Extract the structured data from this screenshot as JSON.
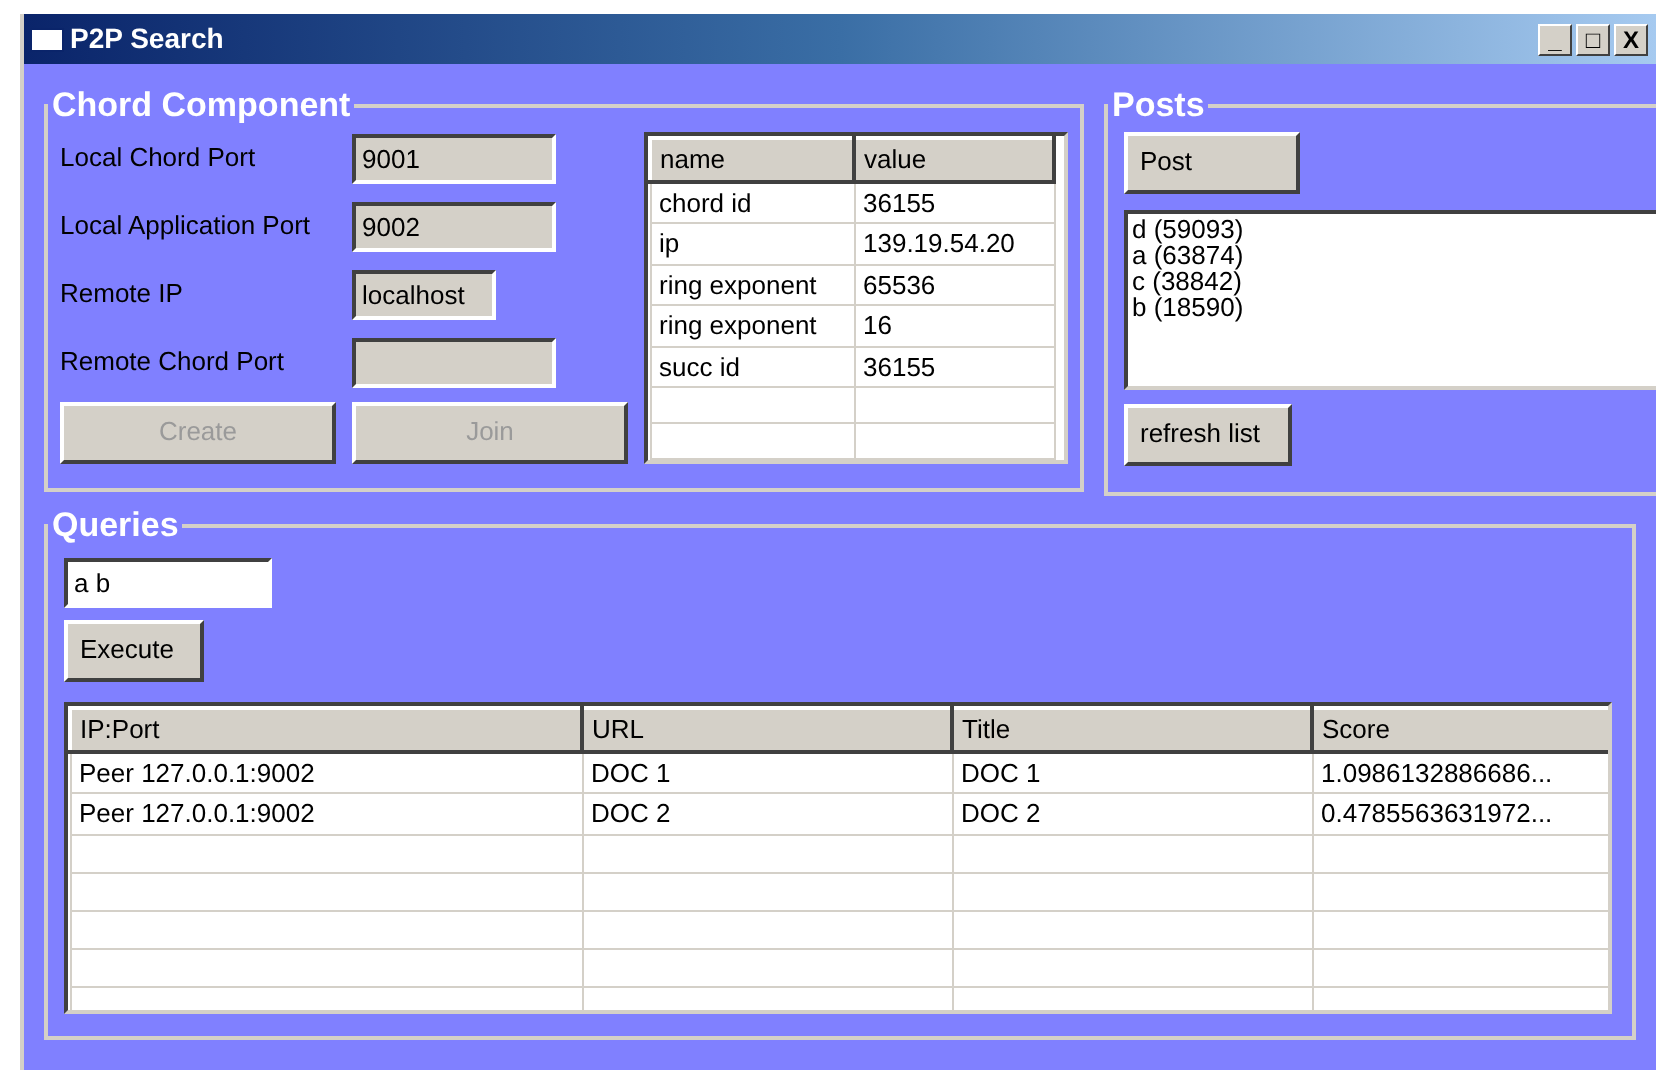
{
  "window": {
    "title": "P2P Search",
    "controls": [
      "_",
      "□",
      "X"
    ]
  },
  "chord": {
    "title": "Chord Component",
    "fields": [
      {
        "label": "Local Chord Port",
        "value": "9001",
        "disabled": true
      },
      {
        "label": "Local Application Port",
        "value": "9002",
        "disabled": true
      },
      {
        "label": "Remote IP",
        "value": "localhost",
        "disabled": true
      },
      {
        "label": "Remote Chord Port",
        "disabled": true
      }
    ],
    "buttons": [
      {
        "label": "Create",
        "disabled": true
      },
      {
        "label": "Join",
        "disabled": true
      }
    ],
    "table": {
      "columns": [
        "name",
        "value"
      ],
      "rows": [
        [
          "chord id",
          "36155"
        ],
        [
          "ip",
          "139.19.54.20"
        ],
        [
          "ring exponent",
          "65536"
        ],
        [
          "ring exponent",
          "16"
        ],
        [
          "succ id",
          "36155"
        ]
      ]
    }
  },
  "posts": {
    "title": "Posts",
    "post_button": {
      "label": "Post",
      "disabled": false
    },
    "items": [
      "d (59093)",
      "a (63874)",
      "c (38842)",
      "b (18590)"
    ],
    "refresh_button": {
      "label": "refresh list",
      "disabled": false
    }
  },
  "queries": {
    "title": "Queries",
    "query": {
      "value": "a b",
      "disabled": false
    },
    "execute_button": {
      "label": "Execute",
      "disabled": false
    },
    "table": {
      "columns": [
        "IP:Port",
        "URL",
        "Title",
        "Score"
      ],
      "rows": [
        [
          "Peer 127.0.0.1:9002",
          "DOC 1",
          "DOC 1",
          "1.0986132886686..."
        ],
        [
          "Peer 127.0.0.1:9002",
          "DOC 2",
          "DOC 2",
          "0.4785563631972..."
        ]
      ]
    }
  }
}
